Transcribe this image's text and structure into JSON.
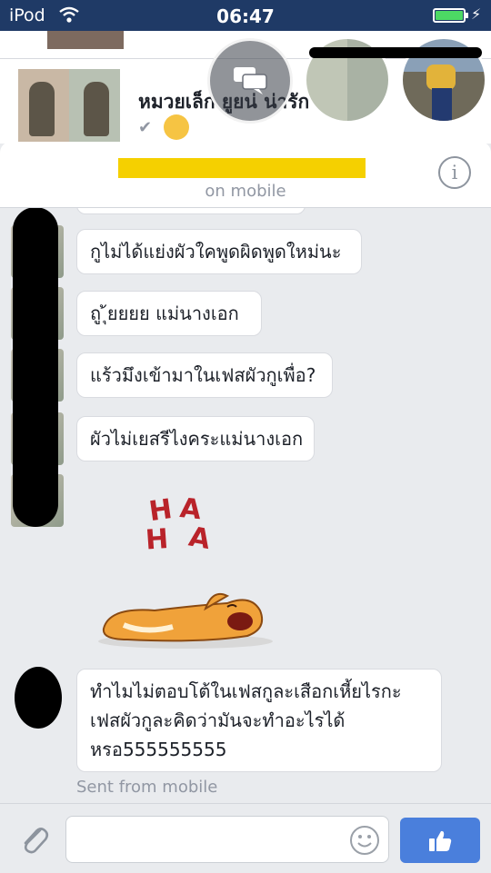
{
  "status_bar": {
    "carrier": "iPod",
    "time": "06:47",
    "battery_level": 1.0,
    "icons": [
      "wifi-icon",
      "battery-icon",
      "charging-bolt-icon"
    ]
  },
  "feed": {
    "post_name": "หมวยเล็ก ยูยน่ น่ารัก",
    "icons": [
      "check-icon",
      "smile-emoji-icon"
    ]
  },
  "chat_header": {
    "status": "on mobile",
    "info_label": "i"
  },
  "messages": [
    {
      "text": ""
    },
    {
      "text": "กูไม่ได้แย่งผัวใคพูดผิดพูดใหม่นะ"
    },
    {
      "text": "ถู ุ้ยยยย แม่นางเอก"
    },
    {
      "text": "แร้วมึงเข้ามาในเฟสผัวกูเพื่อ?"
    },
    {
      "text": "ผัวไม่เยสรีไงคระแม่นางเอก"
    },
    {
      "text": "ทำไมไม่ตอบโต้ในเฟสกูละเสือกเหี้ยไรกะเฟสผัวกูละคิดว่ามันจะทำอะไรได้หรอ555555555"
    }
  ],
  "stickers": {
    "haha_letters": [
      "H",
      "A",
      "H",
      "A"
    ]
  },
  "sent_note": "Sent from mobile",
  "composer": {
    "input_value": "",
    "input_placeholder": "",
    "icons": [
      "paperclip-icon",
      "smiley-icon",
      "thumbs-up-icon"
    ]
  },
  "colors": {
    "status_bar": "#1f3a66",
    "accent": "#4a7fdc",
    "redaction_yellow": "#f5d000",
    "background": "#e9ebee"
  }
}
